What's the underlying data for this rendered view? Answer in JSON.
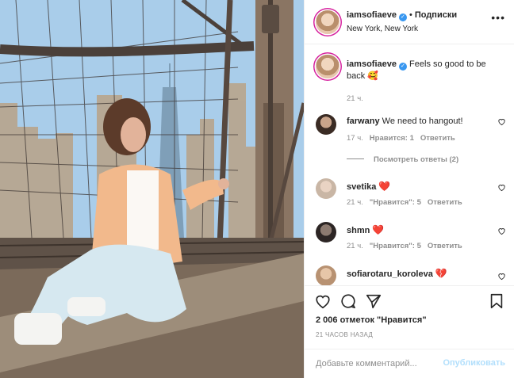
{
  "header": {
    "username": "iamsofiaeve",
    "separator": "•",
    "follow_label": "Подписки",
    "location": "New York, New York",
    "more_label": "•••"
  },
  "caption": {
    "username": "iamsofiaeve",
    "text": "Feels so good to be back 🥰",
    "time": "21 ч."
  },
  "comments": [
    {
      "username": "farwany",
      "text": "We need to hangout!",
      "time": "17 ч.",
      "likes": "Нравится: 1",
      "reply": "Ответить"
    },
    {
      "username": "svetika",
      "text": "❤️",
      "time": "21 ч.",
      "likes": "\"Нравится\": 5",
      "reply": "Ответить"
    },
    {
      "username": "shmn",
      "text": "❤️",
      "time": "21 ч.",
      "likes": "\"Нравится\": 5",
      "reply": "Ответить"
    },
    {
      "username": "sofiarotaru_koroleva",
      "text": "💔",
      "time": "",
      "likes": "",
      "reply": ""
    }
  ],
  "view_replies": "Посмотреть ответы (2)",
  "actions": {
    "likes_text": "2 006 отметок \"Нравится\"",
    "time_ago": "21 ЧАСОВ НАЗАД"
  },
  "add_comment": {
    "placeholder": "Добавьте комментарий...",
    "publish_label": "Опубликовать"
  },
  "colors": {
    "verified": "#3897f0",
    "heart_red": "#ed4956",
    "publish_disabled": "#b2dffc",
    "muted": "#8e8e8e"
  }
}
